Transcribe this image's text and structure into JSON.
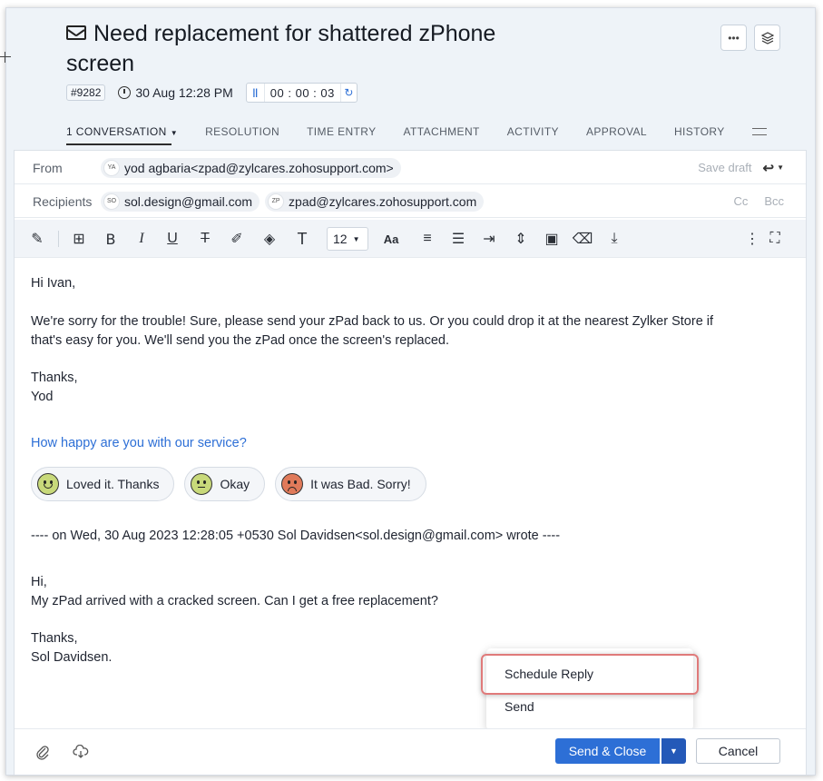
{
  "ticket": {
    "title": "Need replacement for shattered zPhone screen",
    "id": "#9282",
    "due": "30 Aug 12:28 PM",
    "timer": "00 : 00 : 03"
  },
  "header_buttons": {
    "more": "•••"
  },
  "tabs": [
    {
      "label": "1 CONVERSATION"
    },
    {
      "label": "RESOLUTION"
    },
    {
      "label": "TIME ENTRY"
    },
    {
      "label": "ATTACHMENT"
    },
    {
      "label": "ACTIVITY"
    },
    {
      "label": "APPROVAL"
    },
    {
      "label": "HISTORY"
    }
  ],
  "compose": {
    "from_label": "From",
    "from": {
      "initials": "YA",
      "value": "yod agbaria<zpad@zylcares.zohosupport.com>"
    },
    "save_draft": "Save draft",
    "recipients_label": "Recipients",
    "recipients": [
      {
        "initials": "SO",
        "value": "sol.design@gmail.com"
      },
      {
        "initials": "ZP",
        "value": "zpad@zylcares.zohosupport.com"
      }
    ],
    "cc": "Cc",
    "bcc": "Bcc",
    "font_size": "12"
  },
  "message": {
    "greeting": "Hi Ivan,",
    "line1": "We're sorry for the trouble! Sure, please send your zPad back to us. Or you could drop it at the nearest Zylker Store if",
    "line2": "that's easy for you. We'll send you the zPad once the screen's replaced.",
    "sign1": "Thanks,",
    "sign2": "Yod",
    "survey_question": "How happy are you with our service?",
    "ratings": [
      "Loved it. Thanks",
      "Okay",
      "It was Bad. Sorry!"
    ],
    "quote_header": "---- on Wed, 30 Aug 2023 12:28:05 +0530 Sol Davidsen<sol.design@gmail.com> wrote ----",
    "quote_greeting": "Hi,",
    "quote_line": "My zPad arrived with a cracked screen. Can I get a free replacement?",
    "quote_sign1": "Thanks,",
    "quote_sign2": "Sol Davidsen."
  },
  "send_menu": {
    "items": [
      "Schedule Reply",
      "Send"
    ]
  },
  "footer": {
    "send_close": "Send & Close",
    "cancel": "Cancel"
  },
  "colors": {
    "accent": "#2d6fd6",
    "highlight": "#e07a7a"
  }
}
